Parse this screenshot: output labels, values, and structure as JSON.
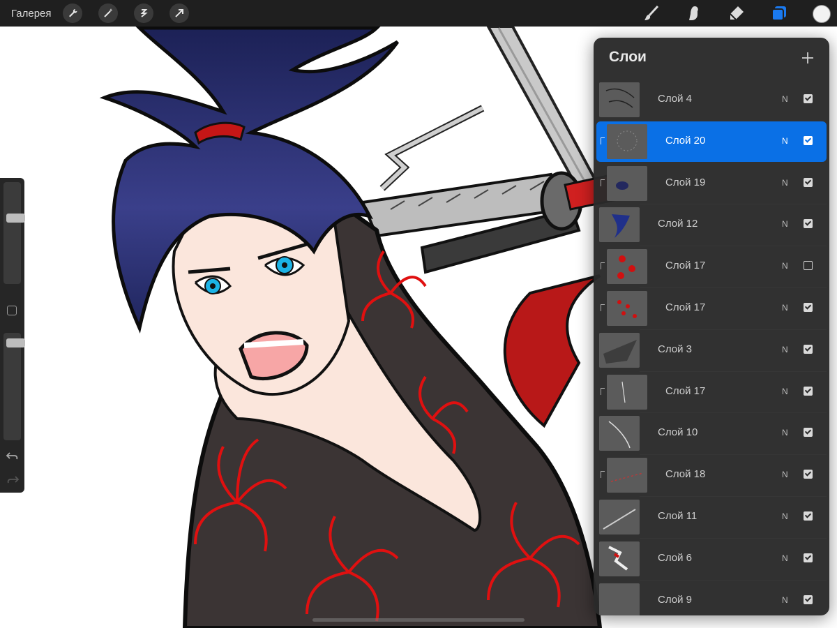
{
  "app": {
    "gallery_label": "Галерея"
  },
  "toolbar": {
    "left_tools": [
      "wrench-icon",
      "magic-wand-icon",
      "selection-icon",
      "transform-icon"
    ],
    "right_tools": [
      "brush-icon",
      "smudge-icon",
      "eraser-icon",
      "layers-icon"
    ],
    "active_tool": "layers-icon",
    "current_color": "#f2f2f2"
  },
  "sidebar": {
    "brush_size_level": 0.45,
    "opacity_level": 0.95
  },
  "layers_panel": {
    "title": "Слои",
    "layers": [
      {
        "name": "Слой 4",
        "blend": "N",
        "visible": true,
        "selected": false,
        "clipped": false
      },
      {
        "name": "Слой 20",
        "blend": "N",
        "visible": true,
        "selected": true,
        "clipped": true
      },
      {
        "name": "Слой 19",
        "blend": "N",
        "visible": true,
        "selected": false,
        "clipped": true
      },
      {
        "name": "Слой 12",
        "blend": "N",
        "visible": true,
        "selected": false,
        "clipped": false
      },
      {
        "name": "Слой 17",
        "blend": "N",
        "visible": false,
        "selected": false,
        "clipped": true
      },
      {
        "name": "Слой 17",
        "blend": "N",
        "visible": true,
        "selected": false,
        "clipped": true
      },
      {
        "name": "Слой 3",
        "blend": "N",
        "visible": true,
        "selected": false,
        "clipped": false
      },
      {
        "name": "Слой 17",
        "blend": "N",
        "visible": true,
        "selected": false,
        "clipped": true
      },
      {
        "name": "Слой 10",
        "blend": "N",
        "visible": true,
        "selected": false,
        "clipped": false
      },
      {
        "name": "Слой 18",
        "blend": "N",
        "visible": true,
        "selected": false,
        "clipped": true
      },
      {
        "name": "Слой 11",
        "blend": "N",
        "visible": true,
        "selected": false,
        "clipped": false
      },
      {
        "name": "Слой 6",
        "blend": "N",
        "visible": true,
        "selected": false,
        "clipped": false
      },
      {
        "name": "Слой 9",
        "blend": "N",
        "visible": true,
        "selected": false,
        "clipped": false
      }
    ]
  },
  "colors": {
    "accent": "#0a70e6",
    "hair": "#242a66",
    "kimono": "#3a3232",
    "flowers": "#d81414",
    "eyes": "#1bb3e6",
    "skin": "#fbe6dc"
  }
}
